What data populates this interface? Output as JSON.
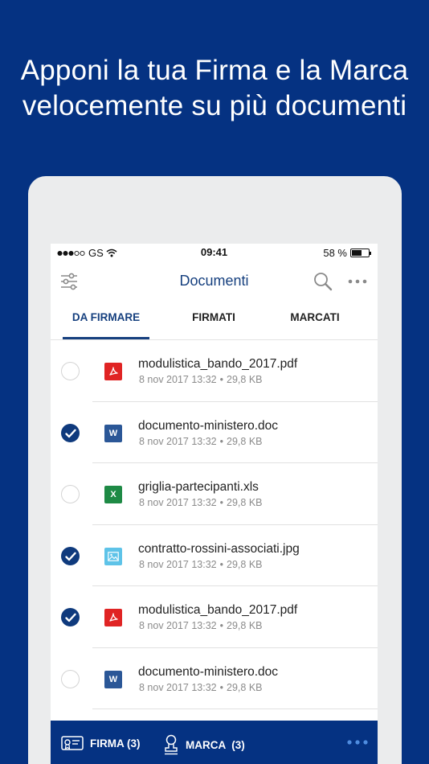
{
  "headline": {
    "line1": "Apponi la tua Firma e la Marca",
    "line2": "velocemente su più documenti"
  },
  "statusbar": {
    "carrier": "GS",
    "time": "09:41",
    "battery": "58 %",
    "battery_level": 0.58
  },
  "navbar": {
    "title": "Documenti",
    "filter_icon": "sliders-icon",
    "search_icon": "search-icon",
    "more_icon": "more-horizontal-icon"
  },
  "tabs": [
    {
      "label": "DA FIRMARE",
      "active": true
    },
    {
      "label": "FIRMATI",
      "active": false
    },
    {
      "label": "MARCATI",
      "active": false
    }
  ],
  "files": [
    {
      "name": "modulistica_bando_2017.pdf",
      "date": "8 nov 2017 13:32",
      "size": "29,8 KB",
      "type": "pdf",
      "checked": false
    },
    {
      "name": "documento-ministero.doc",
      "date": "8 nov 2017 13:32",
      "size": "29,8 KB",
      "type": "doc",
      "checked": true
    },
    {
      "name": "griglia-partecipanti.xls",
      "date": "8 nov 2017 13:32",
      "size": "29,8 KB",
      "type": "xls",
      "checked": false
    },
    {
      "name": "contratto-rossini-associati.jpg",
      "date": "8 nov 2017 13:32",
      "size": "29,8 KB",
      "type": "jpg",
      "checked": true
    },
    {
      "name": "modulistica_bando_2017.pdf",
      "date": "8 nov 2017 13:32",
      "size": "29,8 KB",
      "type": "pdf",
      "checked": true
    },
    {
      "name": "documento-ministero.doc",
      "date": "8 nov 2017 13:32",
      "size": "29,8 KB",
      "type": "doc",
      "checked": false
    }
  ],
  "meta_separator": "•",
  "file_icon_glyphs": {
    "doc": "W",
    "xls": "X"
  },
  "bottombar": {
    "firma_label": "FIRMA (3)",
    "marca_label": "MARCA  (3)"
  },
  "colors": {
    "background": "#053282",
    "accent": "#16407f",
    "pdf": "#e02424",
    "doc": "#2b5797",
    "xls": "#1e8a45",
    "jpg": "#5ec3e8"
  }
}
